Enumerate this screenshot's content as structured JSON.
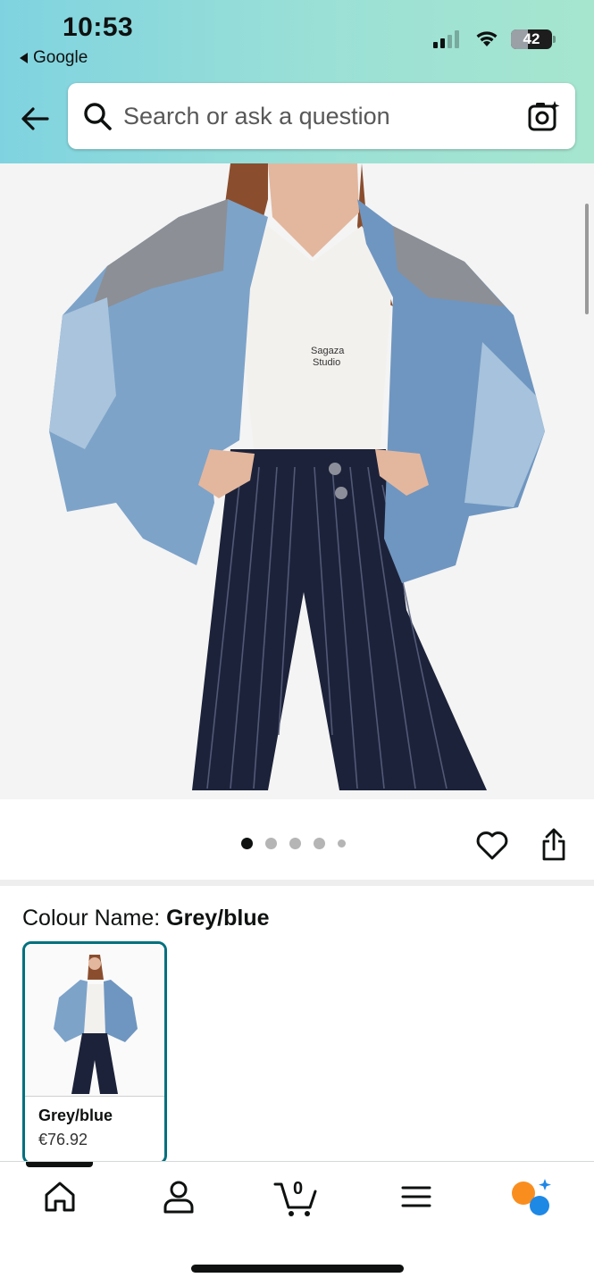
{
  "status_bar": {
    "time": "10:53",
    "back_app": "Google",
    "battery": "42",
    "battery_level_percent": 42
  },
  "search": {
    "placeholder": "Search or ask a question"
  },
  "product": {
    "image_brand_text_line1": "Sagaza",
    "image_brand_text_line2": "Studio",
    "image_count": 5,
    "active_image_index": 0
  },
  "colour": {
    "label": "Colour Name: ",
    "value": "Grey/blue",
    "options": [
      {
        "name": "Grey/blue",
        "price": "€76.92",
        "selected": true
      }
    ]
  },
  "bottom_nav": {
    "items": [
      {
        "icon": "home-icon"
      },
      {
        "icon": "account-icon"
      },
      {
        "icon": "cart-icon"
      },
      {
        "icon": "menu-icon"
      },
      {
        "icon": "rufus-assistant-icon"
      }
    ],
    "cart_count": "0"
  },
  "colors": {
    "header_gradient_start": "#7fd3e0",
    "header_gradient_end": "#a6e6cf",
    "swatch_border": "#00707e",
    "assistant_orange": "#f98e1f",
    "assistant_blue": "#1e88e5"
  }
}
